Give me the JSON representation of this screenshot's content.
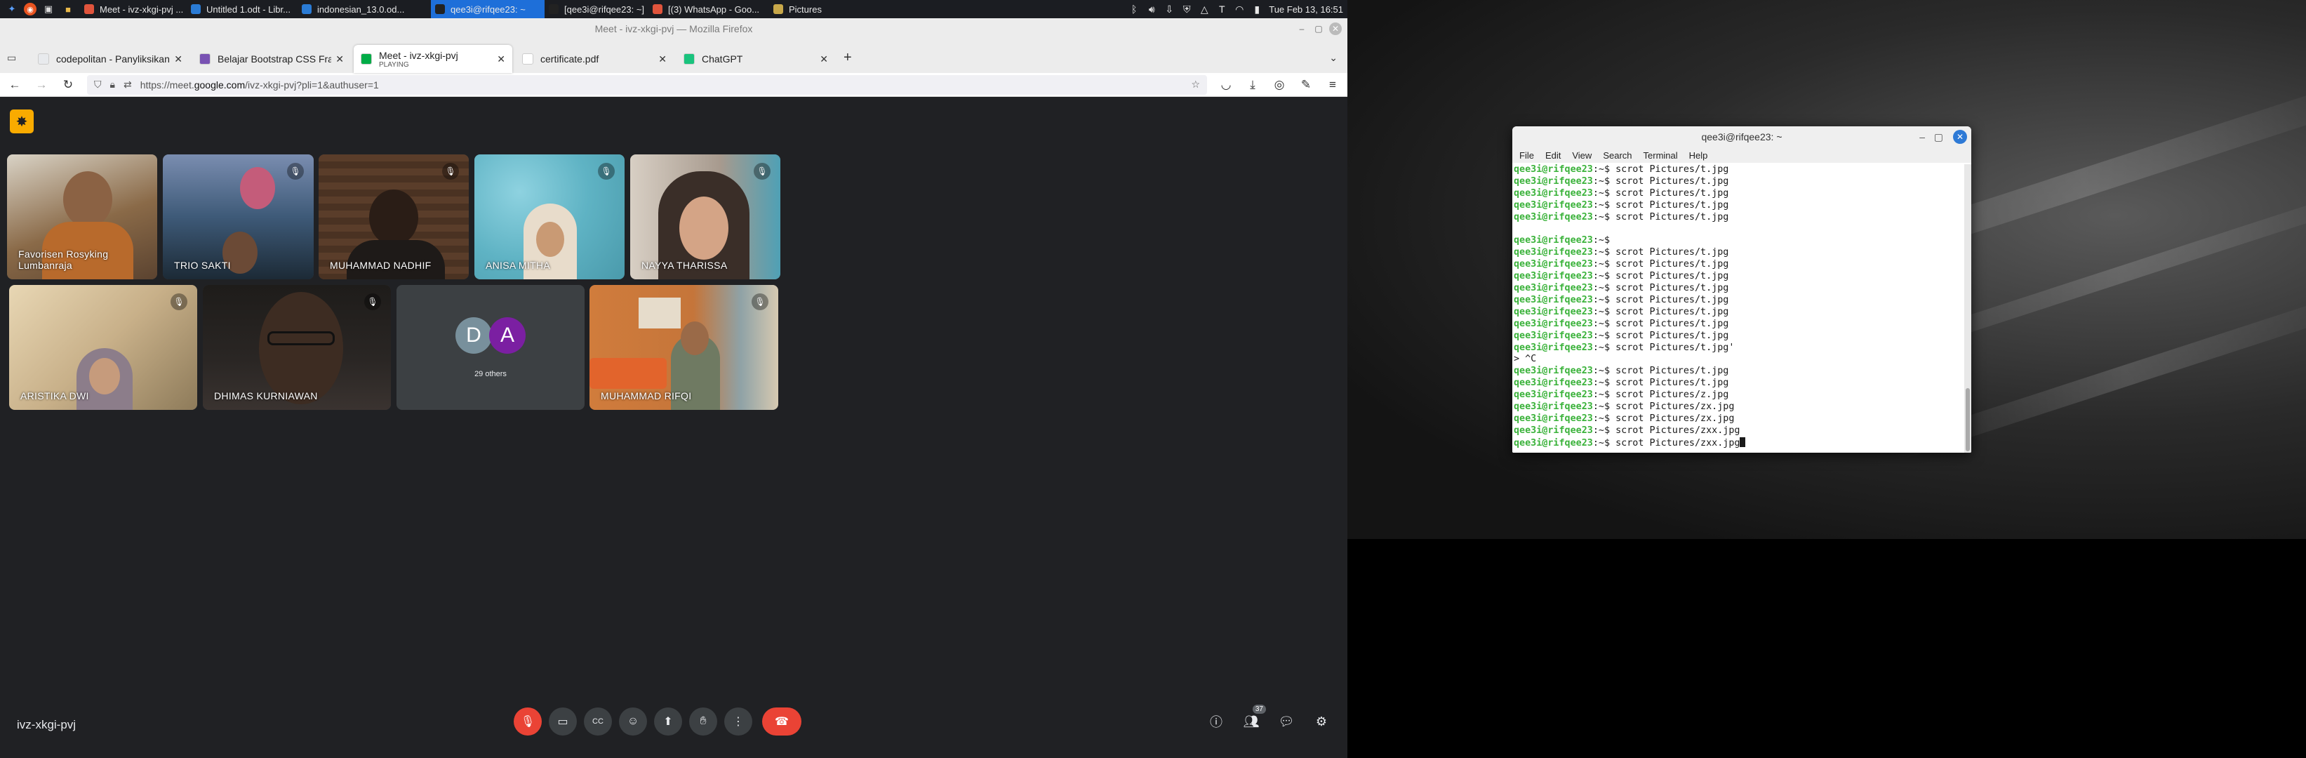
{
  "taskbar": {
    "tasks": [
      {
        "label": "Meet - ivz-xkgi-pvj ...",
        "color": "#e0543c",
        "active": false
      },
      {
        "label": "Untitled 1.odt - Libr...",
        "color": "#2a7bd5",
        "active": false
      },
      {
        "label": "indonesian_13.0.od...",
        "color": "#2a7bd5",
        "active": false
      },
      {
        "label": "qee3i@rifqee23: ~",
        "color": "#222",
        "active": true
      },
      {
        "label": "[qee3i@rifqee23: ~]",
        "color": "#222",
        "active": false
      },
      {
        "label": "[(3) WhatsApp - Goo...",
        "color": "#e0543c",
        "active": false
      },
      {
        "label": "Pictures",
        "color": "#c8a84a",
        "active": false
      }
    ],
    "clock": "Tue Feb 13, 16:51"
  },
  "firefox": {
    "title": "Meet - ivz-xkgi-pvj — Mozilla Firefox",
    "tabs": [
      {
        "title": "codepolitan - Panyliksikan d",
        "sub": "",
        "color": "#e8eaed",
        "active": false
      },
      {
        "title": "Belajar Bootstrap CSS Fram",
        "sub": "",
        "color": "#7952b3",
        "active": false
      },
      {
        "title": "Meet - ivz-xkgi-pvj",
        "sub": "PLAYING",
        "color": "#00ac47",
        "active": true
      },
      {
        "title": "certificate.pdf",
        "sub": "",
        "color": "#ffffff",
        "active": false
      },
      {
        "title": "ChatGPT",
        "sub": "",
        "color": "#19c37d",
        "active": false
      }
    ],
    "url_prefix": "https://meet.",
    "url_domain": "google.com",
    "url_suffix": "/ivz-xkgi-pvj?pli=1&authuser=1"
  },
  "meet": {
    "meeting_code": "ivz-xkgi-pvj",
    "participants": [
      {
        "name": "Favorisen Rosyking Lumbanraja",
        "muted": false,
        "bg": "#6b5a48"
      },
      {
        "name": "TRIO SAKTI",
        "muted": true,
        "bg": "#3e5a78"
      },
      {
        "name": "MUHAMMAD NADHIF",
        "muted": true,
        "bg": "#3a2c24"
      },
      {
        "name": "ANISA MITHA",
        "muted": true,
        "bg": "#5fb3c4"
      },
      {
        "name": "NAYYA THARISSA",
        "muted": true,
        "bg": "#a79a8e"
      },
      {
        "name": "ARISTIKA DWI",
        "muted": true,
        "bg": "#c8b089"
      },
      {
        "name": "DHIMAS KURNIAWAN",
        "muted": true,
        "bg": "#2a2624"
      },
      {
        "name": "MUHAMMAD RIFQI",
        "muted": true,
        "bg": "#c5753a"
      }
    ],
    "others": {
      "label": "29 others",
      "avatars": [
        {
          "letter": "D",
          "color": "#78909c"
        },
        {
          "letter": "A",
          "color": "#7b1fa2"
        }
      ]
    },
    "people_count": "37"
  },
  "terminal": {
    "title": "qee3i@rifqee23: ~",
    "menu": [
      "File",
      "Edit",
      "View",
      "Search",
      "Terminal",
      "Help"
    ],
    "prompt": "qee3i@rifqee23",
    "lines": [
      {
        "p": true,
        "cmd": ":~$ scrot Pictures/t.jpg"
      },
      {
        "p": true,
        "cmd": ":~$ scrot Pictures/t.jpg"
      },
      {
        "p": true,
        "cmd": ":~$ scrot Pictures/t.jpg"
      },
      {
        "p": true,
        "cmd": ":~$ scrot Pictures/t.jpg"
      },
      {
        "p": true,
        "cmd": ":~$ scrot Pictures/t.jpg"
      },
      {
        "p": false,
        "cmd": ""
      },
      {
        "p": true,
        "cmd": ":~$"
      },
      {
        "p": true,
        "cmd": ":~$ scrot Pictures/t.jpg"
      },
      {
        "p": true,
        "cmd": ":~$ scrot Pictures/t.jpg"
      },
      {
        "p": true,
        "cmd": ":~$ scrot Pictures/t.jpg"
      },
      {
        "p": true,
        "cmd": ":~$ scrot Pictures/t.jpg"
      },
      {
        "p": true,
        "cmd": ":~$ scrot Pictures/t.jpg"
      },
      {
        "p": true,
        "cmd": ":~$ scrot Pictures/t.jpg"
      },
      {
        "p": true,
        "cmd": ":~$ scrot Pictures/t.jpg"
      },
      {
        "p": true,
        "cmd": ":~$ scrot Pictures/t.jpg"
      },
      {
        "p": true,
        "cmd": ":~$ scrot Pictures/t.jpg'"
      },
      {
        "p": false,
        "cmd": "> ^C"
      },
      {
        "p": true,
        "cmd": ":~$ scrot Pictures/t.jpg"
      },
      {
        "p": true,
        "cmd": ":~$ scrot Pictures/t.jpg"
      },
      {
        "p": true,
        "cmd": ":~$ scrot Pictures/z.jpg"
      },
      {
        "p": true,
        "cmd": ":~$ scrot Pictures/zx.jpg"
      },
      {
        "p": true,
        "cmd": ":~$ scrot Pictures/zx.jpg"
      },
      {
        "p": true,
        "cmd": ":~$ scrot Pictures/zxx.jpg"
      },
      {
        "p": true,
        "cmd": ":~$ scrot Pictures/zxx.jpg"
      }
    ]
  }
}
